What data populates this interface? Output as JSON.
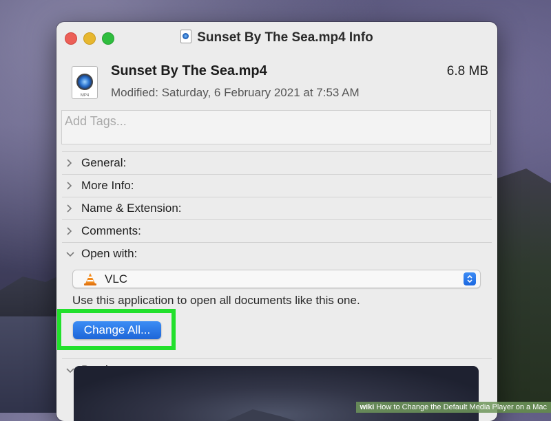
{
  "window": {
    "title": "Sunset By The Sea.mp4 Info"
  },
  "file": {
    "name": "Sunset By The Sea.mp4",
    "size": "6.8 MB",
    "modified": "Modified: Saturday, 6 February 2021 at 7:53 AM",
    "icon_ext": "MP4"
  },
  "tags": {
    "placeholder": "Add Tags...",
    "value": ""
  },
  "sections": {
    "general": "General:",
    "more_info": "More Info:",
    "name_extension": "Name & Extension:",
    "comments": "Comments:",
    "open_with": "Open with:",
    "preview": "Preview:"
  },
  "open_with": {
    "selected_app": "VLC",
    "helper_text": "Use this application to open all documents like this one.",
    "change_all_label": "Change All..."
  },
  "watermark": {
    "brand": "wiki",
    "text": "How to Change the Default Media Player on a Mac"
  },
  "colors": {
    "highlight_frame": "#22e02c",
    "accent_blue": "#1e66d8"
  },
  "icons": {
    "close": "close-traffic-light",
    "minimize": "minimize-traffic-light",
    "zoom": "zoom-traffic-light",
    "chevron_right": "chevron-right-icon",
    "chevron_down": "chevron-down-icon",
    "vlc": "vlc-cone-icon",
    "stepper": "up-down-chevron-icon"
  }
}
